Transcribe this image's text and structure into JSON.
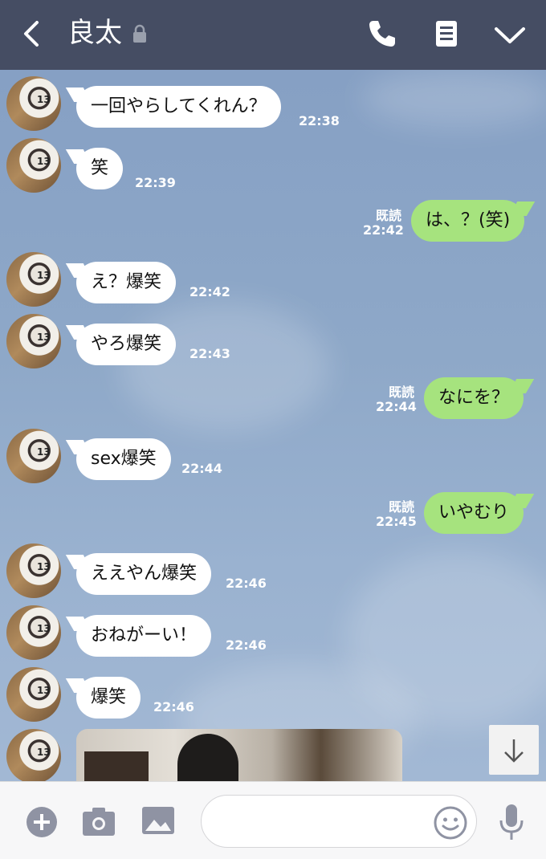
{
  "header": {
    "title": "良太"
  },
  "messages": [
    {
      "side": "in",
      "text": "一回やらしてくれん？",
      "time": "22:38"
    },
    {
      "side": "in",
      "text": "笑",
      "time": "22:39"
    },
    {
      "side": "out",
      "text": "は、？(笑)",
      "time": "22:42",
      "read": "既読"
    },
    {
      "side": "in",
      "text": "え？爆笑",
      "time": "22:42"
    },
    {
      "side": "in",
      "text": "やろ爆笑",
      "time": "22:43"
    },
    {
      "side": "out",
      "text": "なにを？",
      "time": "22:44",
      "read": "既読"
    },
    {
      "side": "in",
      "text": "sex爆笑",
      "time": "22:44"
    },
    {
      "side": "out",
      "text": "いやむり",
      "time": "22:45",
      "read": "既読"
    },
    {
      "side": "in",
      "text": "ええやん爆笑",
      "time": "22:46"
    },
    {
      "side": "in",
      "text": "おねがーい！",
      "time": "22:46"
    },
    {
      "side": "in",
      "text": "爆笑",
      "time": "22:46"
    }
  ],
  "input": {
    "value": "",
    "placeholder": ""
  },
  "colors": {
    "header_bg": "#454d63",
    "outgoing_bubble": "#a6e37e",
    "incoming_bubble": "#ffffff"
  },
  "icons": [
    "back-icon",
    "lock-icon",
    "phone-icon",
    "note-icon",
    "chevron-down-icon",
    "plus-icon",
    "camera-icon",
    "image-icon",
    "emoji-icon",
    "mic-icon",
    "arrow-down-icon"
  ]
}
